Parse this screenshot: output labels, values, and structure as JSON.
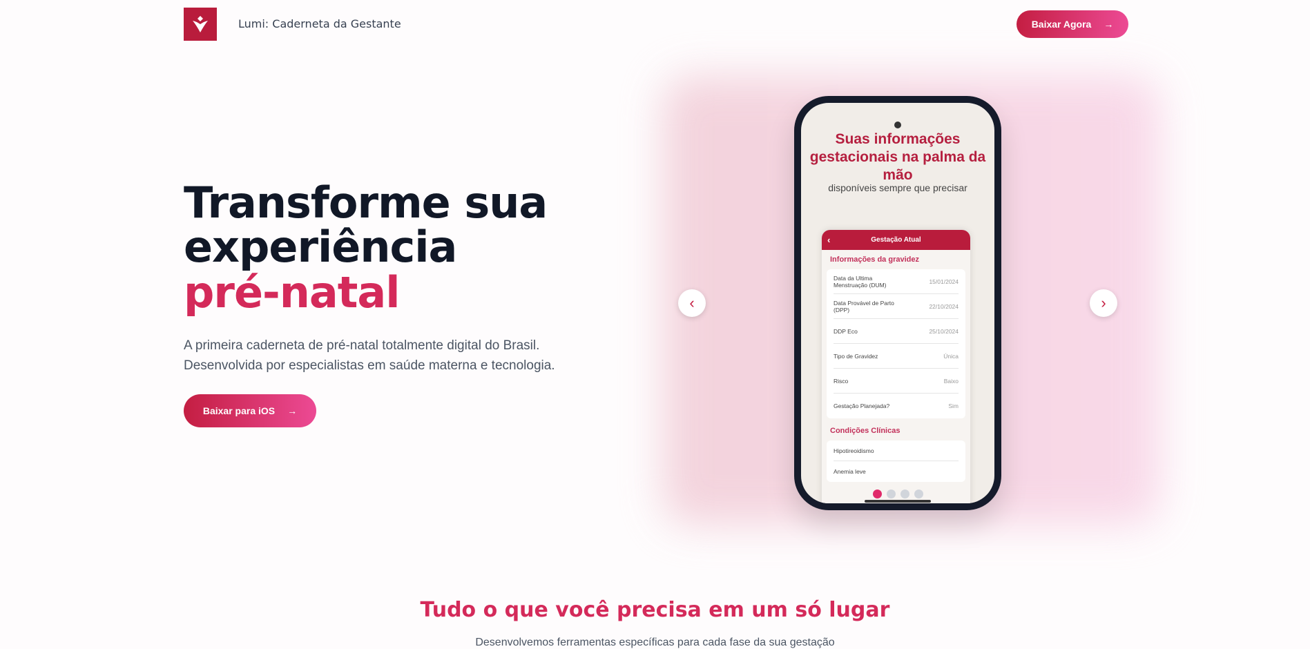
{
  "nav": {
    "title": "Lumi: Caderneta da Gestante",
    "cta": "Baixar Agora",
    "arrow": "→"
  },
  "hero": {
    "line1": "Transforme sua",
    "line2": "experiência",
    "accent": "pré-natal",
    "description1": "A primeira caderneta de pré-natal totalmente digital do Brasil.",
    "description2": "Desenvolvida por especialistas em saúde materna e tecnologia.",
    "cta": "Baixar para iOS",
    "arrow": "→"
  },
  "carousel": {
    "prev": "‹",
    "next": "›",
    "active_slide": 1,
    "total_slides": 4
  },
  "phone": {
    "title": "Suas informações gestacionais na palma da mão",
    "subtitle": "disponíveis sempre que precisar",
    "header": "Gestação Atual",
    "back": "‹",
    "section1": "Informações da gravidez",
    "rows": [
      {
        "label": "Data da Ultima Menstruação (DUM)",
        "value": "15/01/2024"
      },
      {
        "label": "Data Provável de Parto (DPP)",
        "value": "22/10/2024"
      },
      {
        "label": "DDP Eco",
        "value": "25/10/2024"
      },
      {
        "label": "Tipo de Gravidez",
        "value": "Única"
      },
      {
        "label": "Risco",
        "value": "Baixo"
      },
      {
        "label": "Gestação Planejada?",
        "value": "Sim"
      }
    ],
    "section2": "Condições Clínicas",
    "conditions": [
      "Hipotireoidismo",
      "Anemia leve"
    ]
  },
  "features": {
    "title": "Tudo o que você precisa em um só lugar",
    "subtitle": "Desenvolvemos ferramentas específicas para cada fase da sua gestação"
  },
  "colors": {
    "brand": "#b91c3c",
    "accent": "#d42a5a"
  }
}
